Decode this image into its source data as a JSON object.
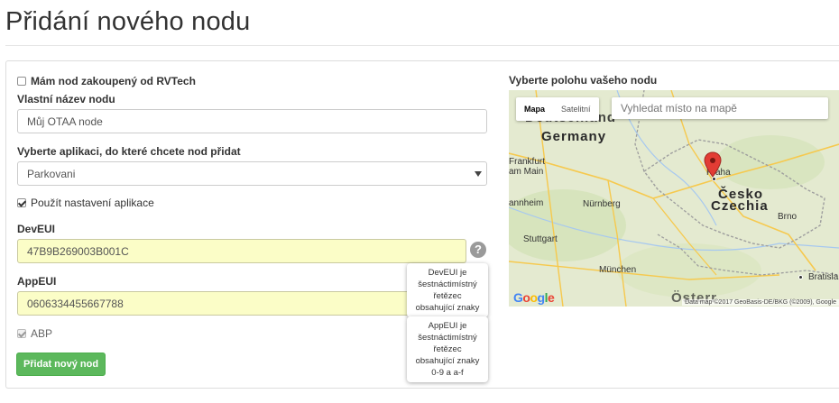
{
  "page": {
    "title": "Přidání nového nodu"
  },
  "form": {
    "bought_checkbox": {
      "label": "Mám nod zakoupený od RVTech",
      "checked": false
    },
    "name": {
      "label": "Vlastní název nodu",
      "value": "Můj OTAA node"
    },
    "application": {
      "label": "Vyberte aplikaci, do které chcete nod přidat",
      "selected": "Parkovani"
    },
    "use_app_settings": {
      "label": "Použít nastavení aplikace",
      "checked": true
    },
    "dev_eui": {
      "label": "DevEUI",
      "value": "47B9B269003B001C",
      "help_icon": "question-circle-icon",
      "tooltip": [
        "DevEUI je",
        "šestnáctimístný",
        "řetězec",
        "obsahující znaky"
      ]
    },
    "app_eui": {
      "label": "AppEUI",
      "value": "0606334455667788",
      "help_icon": "question-circle-icon",
      "tooltip": [
        "AppEUI je",
        "šestnáctimístný",
        "řetězec",
        "obsahující znaky",
        "0-9 a a-f"
      ]
    },
    "abp": {
      "label": "ABP",
      "checked": true,
      "disabled": true
    },
    "submit_label": "Přidat nový nod",
    "submit_color": "#5cb85c"
  },
  "map": {
    "label": "Vyberte polohu vašeho nodu",
    "type_buttons": [
      "Mapa",
      "Satelitní"
    ],
    "active_type": "Mapa",
    "search_placeholder": "Vyhledat místo na mapě",
    "countries": {
      "germany_top": "Deutschland",
      "germany": "Germany",
      "czech_1": "Česko",
      "czech_2": "Czechia",
      "austria_fragment": "Österr"
    },
    "cities": [
      "Frankfurt am Main",
      "Mannheim",
      "Nürnberg",
      "Stuttgart",
      "München",
      "Praha",
      "Brno",
      "Bratislava"
    ],
    "city_labels": {
      "frankfurt_1": "Frankfurt",
      "frankfurt_2": "am Main",
      "mannheim": "annheim",
      "stuttgart": "Stuttgart",
      "nurnberg": "Nürnberg",
      "munchen": "München",
      "praha": "Praha",
      "brno": "Brno",
      "bratislava": "Bratisla"
    },
    "logo": "Google",
    "attribution": "Data map ©2017 GeoBasis-DE/BKG (©2009), Google",
    "marker_icon": "map-pin-icon",
    "marker_color": "#e23c34"
  }
}
